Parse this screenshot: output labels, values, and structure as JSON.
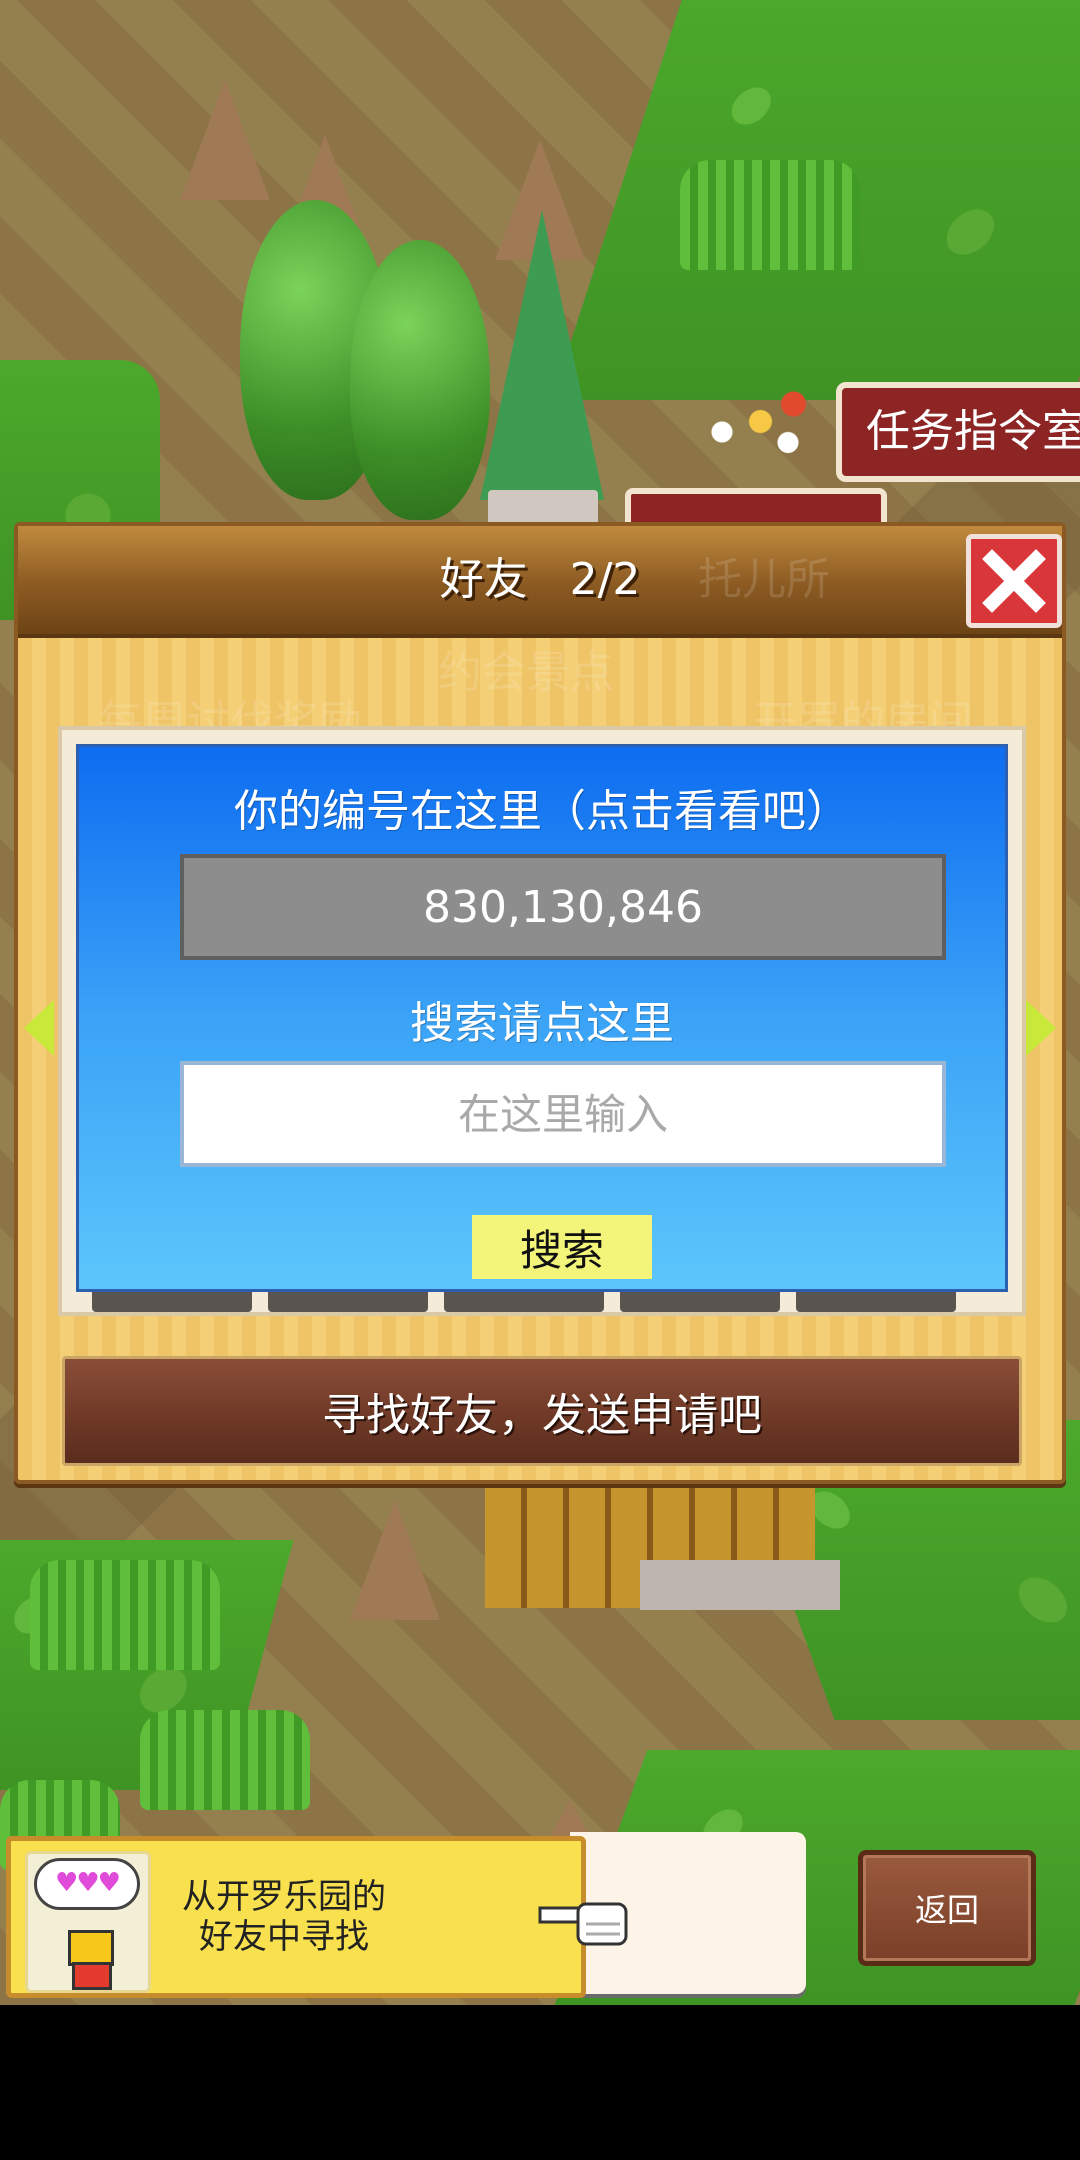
{
  "background": {
    "building_tags": [
      "任务指令室"
    ]
  },
  "dialog": {
    "title": "好友",
    "page_indicator": "2/2",
    "ghost_labels": [
      "托儿所",
      "约会景点",
      "每周讨伐奖励",
      "开罗的房间"
    ],
    "id_label": "你的编号在这里（点击看看吧）",
    "id_value": "830,130,846",
    "search_label": "搜索请点这里",
    "search_placeholder": "在这里输入",
    "search_button": "搜索",
    "find_friends_button": "寻找好友，发送申请吧"
  },
  "tip": {
    "bubble": "♥♥♥",
    "line1": "从开罗乐园的",
    "line2": "好友中寻找"
  },
  "back_button": "返回",
  "colors": {
    "panel_blue_top": "#0d6cf0",
    "panel_blue_bottom": "#5cc6fb",
    "close_red": "#d9363a",
    "search_button_yellow": "#f2f57a",
    "find_button_brown": "#6d3826"
  }
}
